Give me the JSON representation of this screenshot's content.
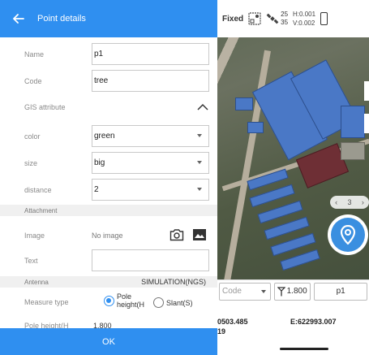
{
  "header": {
    "title": "Point details"
  },
  "form": {
    "name": {
      "label": "Name",
      "value": "p1"
    },
    "code": {
      "label": "Code",
      "value": "tree"
    },
    "gis_section": {
      "label": "GIS attribute"
    },
    "color": {
      "label": "color",
      "value": "green"
    },
    "size": {
      "label": "size",
      "value": "big"
    },
    "distance": {
      "label": "distance",
      "value": "2"
    },
    "attachment_section": {
      "label": "Attachment"
    },
    "image": {
      "label": "Image",
      "value": "No image"
    },
    "text": {
      "label": "Text",
      "value": ""
    },
    "antenna_section": {
      "label": "Antenna",
      "value": "SIMULATION(NGS)"
    },
    "measure_type": {
      "label": "Measure type",
      "options": [
        {
          "label": "Pole height(H",
          "selected": true
        },
        {
          "label": "Slant(S)",
          "selected": false
        }
      ]
    },
    "pole_height": {
      "label": "Pole height(H",
      "value": "1.800"
    }
  },
  "ok_button": {
    "label": "OK"
  },
  "status": {
    "fix": "Fixed",
    "sat_used": "25",
    "sat_total": "35",
    "h_precision": "H:0.001",
    "v_precision": "V:0.002"
  },
  "map": {
    "zoom_label": "3",
    "code_placeholder": "Code",
    "pole_height": "1.800",
    "point_name": "p1",
    "north_line1": "0503.485",
    "north_line2": "19",
    "east": "E:622993.007"
  },
  "colors": {
    "accent": "#2f8ff0",
    "building": "#4a78c6"
  }
}
